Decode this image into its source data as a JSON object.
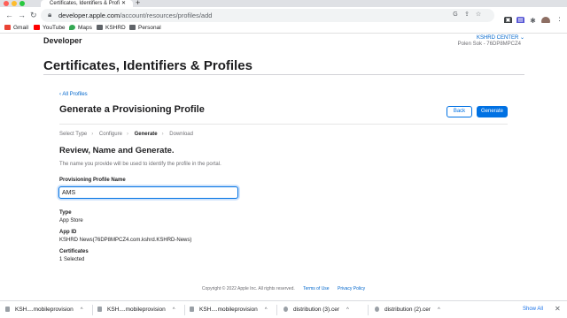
{
  "browser": {
    "tab_title": "Certificates, Identifiers & Profi",
    "url_host": "developer.apple.com",
    "url_path": "/account/resources/profiles/add",
    "bookmarks": [
      {
        "label": "Gmail",
        "icon": "gmail-icon",
        "color": "#ea4335"
      },
      {
        "label": "YouTube",
        "icon": "youtube-icon",
        "color": "#ff0000"
      },
      {
        "label": "Maps",
        "icon": "maps-icon",
        "color": "#34a853"
      },
      {
        "label": "KSHRD",
        "icon": "folder-icon",
        "color": "#5f6368"
      },
      {
        "label": "Personal",
        "icon": "folder-icon",
        "color": "#5f6368"
      }
    ]
  },
  "header": {
    "brand": "Developer",
    "team_name": "KSHRD CENTER ⌄",
    "team_id": "Polen Sok - 76DP8MPCZ4"
  },
  "page": {
    "title": "Certificates, Identifiers & Profiles",
    "back_link": "‹ All Profiles",
    "heading": "Generate a Provisioning Profile",
    "back_button": "Back",
    "generate_button": "Generate"
  },
  "steps": [
    "Select Type",
    "Configure",
    "Generate",
    "Download"
  ],
  "review": {
    "title": "Review, Name and Generate.",
    "description": "The name you provide will be used to identify the profile in the portal.",
    "name_label": "Provisioning Profile Name",
    "name_value": "AMS"
  },
  "details": {
    "type_label": "Type",
    "type_value": "App Store",
    "appid_label": "App ID",
    "appid_value": "KSHRD News(76DP8MPCZ4.com.kshrd.KSHRD-News)",
    "certs_label": "Certificates",
    "certs_value": "1 Selected"
  },
  "footer": {
    "copyright": "Copyright © 2022 Apple Inc. All rights reserved.",
    "terms": "Terms of Use",
    "privacy": "Privacy Policy"
  },
  "downloads": {
    "items": [
      "KSH....mobileprovision",
      "KSH....mobileprovision",
      "KSH....mobileprovision",
      "distribution (3).cer",
      "distribution (2).cer"
    ],
    "show_all": "Show All"
  },
  "colors": {
    "accent": "#0071e3",
    "link": "#0066cc"
  }
}
